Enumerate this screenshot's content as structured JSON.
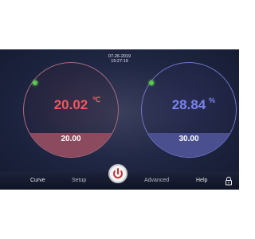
{
  "header": {
    "date": "07-26-2019",
    "time": "15:27:19"
  },
  "left_dial": {
    "value": "20.02",
    "unit": "℃",
    "setpoint": "20.00",
    "indicator_color": "#58c84a",
    "accent_color": "#f0575e"
  },
  "right_dial": {
    "value": "28.84",
    "unit": "%",
    "setpoint": "30.00",
    "indicator_color": "#58c84a",
    "accent_color": "#7a84ee"
  },
  "nav": {
    "curve": "Curve",
    "setup": "Setup",
    "advanced": "Advanced",
    "help": "Help",
    "power_icon": "power-icon",
    "lock_icon": "lock-icon"
  }
}
